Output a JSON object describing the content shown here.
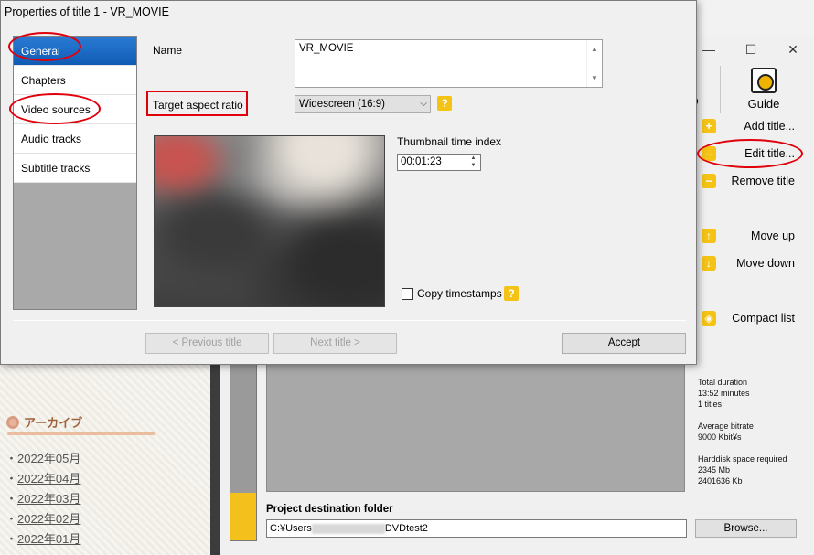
{
  "dialog": {
    "title": "Properties of title 1 - VR_MOVIE",
    "nav": [
      "General",
      "Chapters",
      "Video sources",
      "Audio tracks",
      "Subtitle tracks"
    ],
    "name_label": "Name",
    "name_value": "VR_MOVIE",
    "aspect_label": "Target aspect ratio",
    "aspect_value": "Widescreen (16:9)",
    "thumb_label": "Thumbnail time index",
    "thumb_time": "00:01:23",
    "copy_timestamps": "Copy timestamps",
    "prev_button": "< Previous title",
    "next_button": "Next title >",
    "accept_button": "Accept",
    "help_glyph": "?"
  },
  "main": {
    "toolbar_partial": "D",
    "guide_label": "Guide",
    "actions": [
      {
        "label": "Add title...",
        "glyph": "+"
      },
      {
        "label": "Edit title...",
        "glyph": "..."
      },
      {
        "label": "Remove title",
        "glyph": "−"
      },
      {
        "label": "Move up",
        "glyph": "↑"
      },
      {
        "label": "Move down",
        "glyph": "↓"
      },
      {
        "label": "Compact list",
        "glyph": "◈"
      }
    ],
    "stats": {
      "total_duration_label": "Total duration",
      "total_duration_value": "13:52 minutes",
      "titles_count": "1 titles",
      "avg_bitrate_label": "Average bitrate",
      "avg_bitrate_value": "9000 Kbit¥s",
      "disk_label": "Harddisk space required",
      "disk_mb": "2345 Mb",
      "disk_kb": "2401636 Kb"
    },
    "dest_label": "Project destination folder",
    "dest_prefix": "C:¥Users",
    "dest_suffix": "DVDtest2",
    "browse_button": "Browse..."
  },
  "blog": {
    "archive_title": "アーカイブ",
    "months": [
      "2022年05月",
      "2022年04月",
      "2022年03月",
      "2022年02月",
      "2022年01月"
    ]
  }
}
